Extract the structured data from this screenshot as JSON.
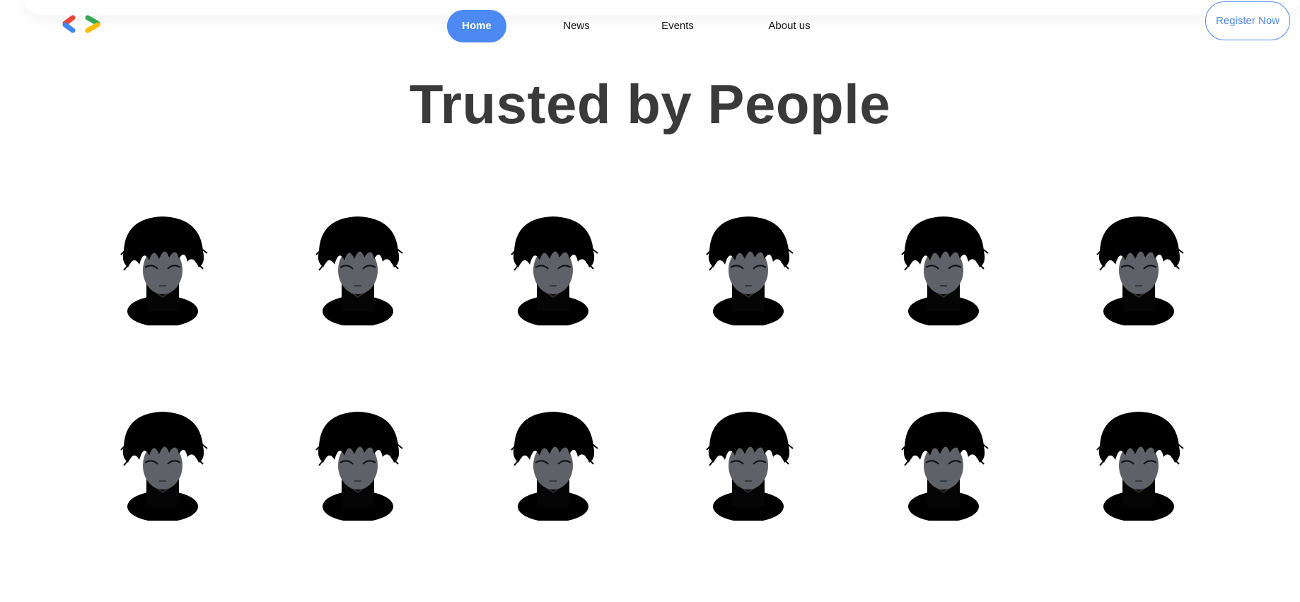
{
  "nav": {
    "items": [
      {
        "label": "Home",
        "active": true
      },
      {
        "label": "News",
        "active": false
      },
      {
        "label": "Events",
        "active": false
      },
      {
        "label": "About us",
        "active": false
      }
    ],
    "register_label": "Register Now"
  },
  "hero": {
    "title": "Trusted by People"
  },
  "people": {
    "avatar_count": 12,
    "columns": 6,
    "rows": 2,
    "avatar_icon": "dark-haired-person-avatar-icon"
  },
  "colors": {
    "accent": "#4d89f3",
    "title_text": "#3a3a3a",
    "logo_red": "#ea4335",
    "logo_blue": "#4285f4",
    "logo_green": "#34a853",
    "logo_yellow": "#fbbc04"
  }
}
